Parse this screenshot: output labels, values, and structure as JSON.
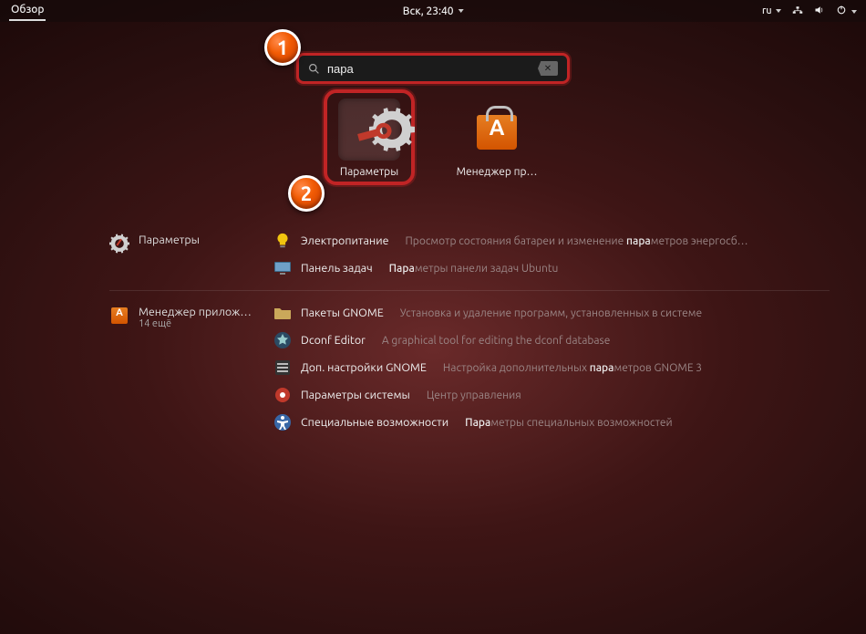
{
  "topbar": {
    "overview_label": "Обзор",
    "clock": "Вск, 23:40",
    "language": "ru"
  },
  "search": {
    "query": "пара",
    "clear_symbol": "✕"
  },
  "apps": [
    {
      "id": "settings-app",
      "label": "Параметры",
      "icon": "gear-wrench-icon",
      "selected": true
    },
    {
      "id": "software-app",
      "label": "Менеджер пр…",
      "icon": "shopping-bag-icon",
      "selected": false
    }
  ],
  "markers": {
    "m1": "1",
    "m2": "2"
  },
  "categories": [
    {
      "id": "settings-category",
      "title": "Параметры",
      "subtitle": "",
      "icon": "gear-wrench-icon",
      "items": [
        {
          "icon": "bulb-icon",
          "name": "Электропитание",
          "desc_pre": "Просмотр состояния батареи и изменение ",
          "desc_hl": "пара",
          "desc_post": "метров энергосб…"
        },
        {
          "icon": "monitor-icon",
          "name": "Панель задач",
          "desc_pre": "",
          "desc_hl": "Пара",
          "desc_post": "метры панели задач Ubuntu"
        }
      ]
    },
    {
      "id": "software-category",
      "title": "Менеджер прилож…",
      "subtitle": "14 ещё",
      "icon": "shopping-bag-icon",
      "items": [
        {
          "icon": "folder-icon",
          "name": "Пакеты GNOME",
          "desc_pre": "Установка и удаление программ, установленных в системе",
          "desc_hl": "",
          "desc_post": ""
        },
        {
          "icon": "dconf-icon",
          "name": "Dconf Editor",
          "desc_pre": "A graphical tool for editing the dconf database",
          "desc_hl": "",
          "desc_post": ""
        },
        {
          "icon": "tweak-icon",
          "name": "Доп. настройки GNOME",
          "desc_pre": "Настройка дополнительных ",
          "desc_hl": "пара",
          "desc_post": "метров GNOME 3"
        },
        {
          "icon": "sysgear-icon",
          "name": "Параметры системы",
          "desc_pre": "Центр управления",
          "desc_hl": "",
          "desc_post": ""
        },
        {
          "icon": "access-icon",
          "name": "Специальные возможности",
          "desc_pre": "",
          "desc_hl": "Пара",
          "desc_post": "метры специальных возможностей"
        }
      ]
    }
  ]
}
